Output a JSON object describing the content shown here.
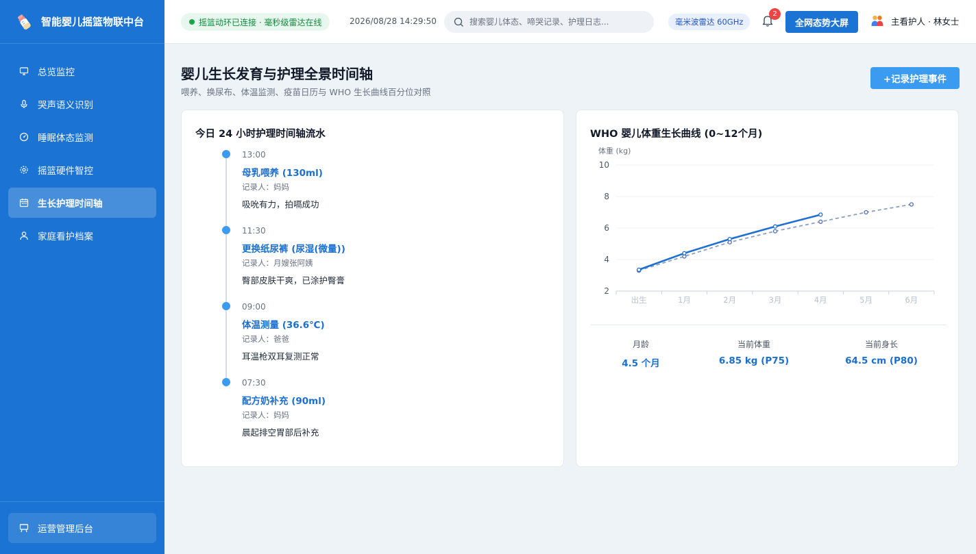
{
  "app": {
    "title": "智能婴儿摇篮物联中台"
  },
  "sidebar": {
    "items": [
      {
        "label": "总览监控",
        "icon": "monitor-icon"
      },
      {
        "label": "哭声语义识别",
        "icon": "microphone-icon"
      },
      {
        "label": "睡眠体态监测",
        "icon": "gauge-icon"
      },
      {
        "label": "摇篮硬件智控",
        "icon": "gear-icon"
      },
      {
        "label": "生长护理时间轴",
        "icon": "calendar-icon",
        "active": true
      },
      {
        "label": "家庭看护档案",
        "icon": "user-icon"
      }
    ],
    "footer_label": "运营管理后台"
  },
  "topbar": {
    "connection_status": "摇篮动环已连接 · 毫秒级雷达在线",
    "datetime": "2026/08/28 14:29:50",
    "search_placeholder": "搜索婴儿体态、啼哭记录、护理日志...",
    "radar_tag": "毫米波雷达 60GHz",
    "notification_count": "2",
    "big_screen_label": "全网态势大屏",
    "user_label": "主看护人 · 林女士"
  },
  "page": {
    "title": "婴儿生长发育与护理全景时间轴",
    "subtitle": "喂养、换尿布、体温监测、疫苗日历与 WHO 生长曲线百分位对照",
    "record_button": "+记录护理事件"
  },
  "timeline": {
    "title": "今日 24 小时护理时间轴流水",
    "events": [
      {
        "time": "13:00",
        "event": "母乳喂养 (130ml)",
        "recorder": "记录人：妈妈",
        "note": "吸吮有力，拍嗝成功"
      },
      {
        "time": "11:30",
        "event": "更换纸尿裤 (尿湿(微量))",
        "recorder": "记录人：月嫂张阿姨",
        "note": "臀部皮肤干爽，已涂护臀膏"
      },
      {
        "time": "09:00",
        "event": "体温测量 (36.6℃)",
        "recorder": "记录人：爸爸",
        "note": "耳温枪双耳复测正常"
      },
      {
        "time": "07:30",
        "event": "配方奶补充 (90ml)",
        "recorder": "记录人：妈妈",
        "note": "晨起排空胃部后补充"
      }
    ]
  },
  "growth": {
    "title": "WHO 婴儿体重生长曲线 (0~12个月)",
    "stats": [
      {
        "label": "月龄",
        "value": "4.5 个月"
      },
      {
        "label": "当前体重",
        "value": "6.85 kg (P75)"
      },
      {
        "label": "当前身长",
        "value": "64.5 cm (P80)"
      }
    ]
  },
  "colors": {
    "primary": "#1b73d3",
    "accent": "#3a9bf0",
    "baby_series": "#1f6fd1",
    "who_series": "#8aa0bf"
  },
  "chart_data": {
    "type": "line",
    "title": "",
    "ylabel": "体重 (kg)",
    "xlabel": "",
    "categories": [
      "出生",
      "1月",
      "2月",
      "3月",
      "4月",
      "5月",
      "6月"
    ],
    "ylim": [
      2,
      10
    ],
    "yticks": [
      2,
      4,
      6,
      8,
      10
    ],
    "grid": true,
    "series": [
      {
        "values": [
          3.35,
          4.4,
          5.3,
          6.1,
          6.85,
          null,
          null
        ],
        "style": "solid"
      },
      {
        "values": [
          3.3,
          4.2,
          5.1,
          5.8,
          6.4,
          7.0,
          7.5
        ],
        "style": "dashed"
      }
    ]
  }
}
